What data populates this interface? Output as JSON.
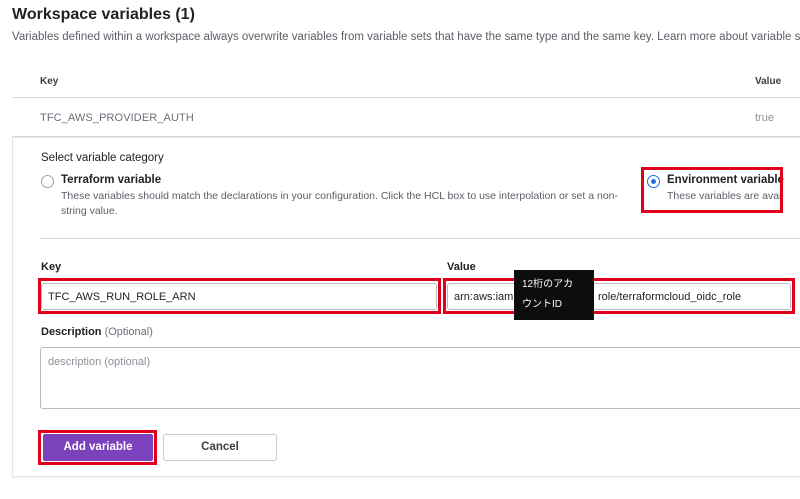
{
  "header": {
    "title": "Workspace variables (1)",
    "description": "Variables defined within a workspace always overwrite variables from variable sets that have the same type and the same key. Learn more about variable s"
  },
  "table": {
    "columns": {
      "key": "Key",
      "value": "Value"
    },
    "rows": [
      {
        "key": "TFC_AWS_PROVIDER_AUTH",
        "value": "true"
      }
    ]
  },
  "form": {
    "category_title": "Select variable category",
    "options": [
      {
        "label": "Terraform variable",
        "description_line1": "These variables should match the declarations in your configuration. Click the HCL box to use interpolation or set a non-",
        "description_line2": "string value.",
        "selected": false
      },
      {
        "label": "Environment variable",
        "description": "These variables are availab",
        "selected": true
      }
    ],
    "key_label": "Key",
    "key_value": "TFC_AWS_RUN_ROLE_ARN",
    "value_label": "Value",
    "value_prefix": "arn:aws:iam",
    "value_suffix": "role/terraformcloud_oidc_role",
    "description_label": "Description",
    "description_optional": "(Optional)",
    "description_placeholder": "description (optional)",
    "tooltip_line1": "12桁のアカ",
    "tooltip_line2": "ウントID",
    "add_button": "Add variable",
    "cancel_button": "Cancel"
  },
  "colors": {
    "primary": "#7b42bc",
    "highlight": "#e0001a",
    "radio_selected": "#1f6feb"
  }
}
